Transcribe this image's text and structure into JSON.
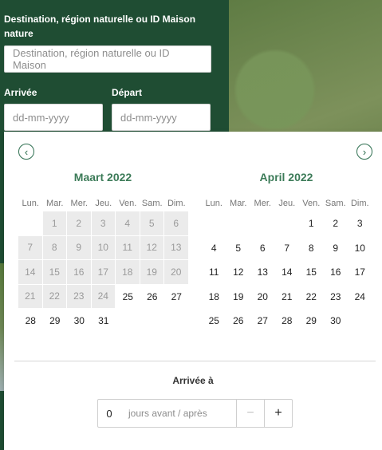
{
  "form": {
    "destination_label": "Destination, région naturelle ou ID Maison nature",
    "destination_placeholder": "Destination, région naturelle ou ID Maison",
    "arrival_label": "Arrivée",
    "arrival_placeholder": "dd-mm-yyyy",
    "departure_label": "Départ",
    "departure_placeholder": "dd-mm-yyyy"
  },
  "datepicker": {
    "prev_icon": "chevron-left-icon",
    "next_icon": "chevron-right-icon",
    "weekdays": [
      "Lun.",
      "Mar.",
      "Mer.",
      "Jeu.",
      "Ven.",
      "Sam.",
      "Dim."
    ],
    "months": [
      {
        "title": "Maart 2022",
        "weeks": [
          [
            {
              "d": "",
              "s": "empty"
            },
            {
              "d": "1",
              "s": "dis"
            },
            {
              "d": "2",
              "s": "dis"
            },
            {
              "d": "3",
              "s": "dis"
            },
            {
              "d": "4",
              "s": "dis"
            },
            {
              "d": "5",
              "s": "dis"
            },
            {
              "d": "6",
              "s": "dis"
            }
          ],
          [
            {
              "d": "7",
              "s": "dis"
            },
            {
              "d": "8",
              "s": "dis"
            },
            {
              "d": "9",
              "s": "dis"
            },
            {
              "d": "10",
              "s": "dis"
            },
            {
              "d": "11",
              "s": "dis"
            },
            {
              "d": "12",
              "s": "dis"
            },
            {
              "d": "13",
              "s": "dis"
            }
          ],
          [
            {
              "d": "14",
              "s": "dis"
            },
            {
              "d": "15",
              "s": "dis"
            },
            {
              "d": "16",
              "s": "dis"
            },
            {
              "d": "17",
              "s": "dis"
            },
            {
              "d": "18",
              "s": "dis"
            },
            {
              "d": "19",
              "s": "dis"
            },
            {
              "d": "20",
              "s": "dis"
            }
          ],
          [
            {
              "d": "21",
              "s": "dis"
            },
            {
              "d": "22",
              "s": "dis"
            },
            {
              "d": "23",
              "s": "dis"
            },
            {
              "d": "24",
              "s": "dis"
            },
            {
              "d": "25",
              "s": "on"
            },
            {
              "d": "26",
              "s": "on"
            },
            {
              "d": "27",
              "s": "on"
            }
          ],
          [
            {
              "d": "28",
              "s": "on"
            },
            {
              "d": "29",
              "s": "on"
            },
            {
              "d": "30",
              "s": "on"
            },
            {
              "d": "31",
              "s": "on"
            },
            {
              "d": "",
              "s": "empty"
            },
            {
              "d": "",
              "s": "empty"
            },
            {
              "d": "",
              "s": "empty"
            }
          ]
        ]
      },
      {
        "title": "April 2022",
        "weeks": [
          [
            {
              "d": "",
              "s": "empty"
            },
            {
              "d": "",
              "s": "empty"
            },
            {
              "d": "",
              "s": "empty"
            },
            {
              "d": "",
              "s": "empty"
            },
            {
              "d": "1",
              "s": "on"
            },
            {
              "d": "2",
              "s": "on"
            },
            {
              "d": "3",
              "s": "on"
            }
          ],
          [
            {
              "d": "4",
              "s": "on"
            },
            {
              "d": "5",
              "s": "on"
            },
            {
              "d": "6",
              "s": "on"
            },
            {
              "d": "7",
              "s": "on"
            },
            {
              "d": "8",
              "s": "on"
            },
            {
              "d": "9",
              "s": "on"
            },
            {
              "d": "10",
              "s": "on"
            }
          ],
          [
            {
              "d": "11",
              "s": "on"
            },
            {
              "d": "12",
              "s": "on"
            },
            {
              "d": "13",
              "s": "on"
            },
            {
              "d": "14",
              "s": "on"
            },
            {
              "d": "15",
              "s": "on"
            },
            {
              "d": "16",
              "s": "on"
            },
            {
              "d": "17",
              "s": "on"
            }
          ],
          [
            {
              "d": "18",
              "s": "on"
            },
            {
              "d": "19",
              "s": "on"
            },
            {
              "d": "20",
              "s": "on"
            },
            {
              "d": "21",
              "s": "on"
            },
            {
              "d": "22",
              "s": "on"
            },
            {
              "d": "23",
              "s": "on"
            },
            {
              "d": "24",
              "s": "on"
            }
          ],
          [
            {
              "d": "25",
              "s": "on"
            },
            {
              "d": "26",
              "s": "on"
            },
            {
              "d": "27",
              "s": "on"
            },
            {
              "d": "28",
              "s": "on"
            },
            {
              "d": "29",
              "s": "on"
            },
            {
              "d": "30",
              "s": "on"
            },
            {
              "d": "",
              "s": "empty"
            }
          ]
        ]
      }
    ],
    "arrival_offset_title": "Arrivée à",
    "offset_value": "0",
    "offset_label": "jours avant / après",
    "minus_label": "−",
    "plus_label": "+"
  },
  "colors": {
    "panel_green": "#1f4d33",
    "month_title": "#3c7b58",
    "disabled_day_bg": "#ebebeb"
  }
}
